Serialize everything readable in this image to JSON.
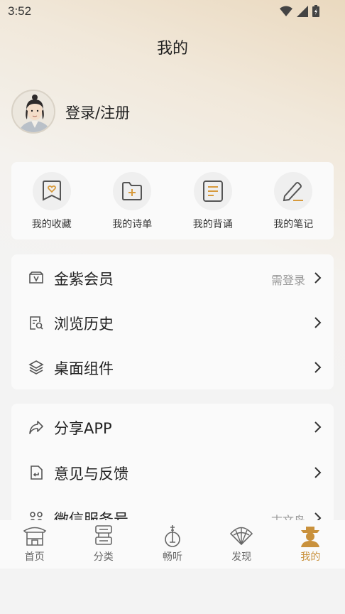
{
  "status": {
    "time": "3:52"
  },
  "header": {
    "title": "我的"
  },
  "profile": {
    "login_label": "登录/注册"
  },
  "shortcuts": [
    {
      "label": "我的收藏",
      "icon": "bookmark-heart-icon"
    },
    {
      "label": "我的诗单",
      "icon": "folder-plus-icon"
    },
    {
      "label": "我的背诵",
      "icon": "document-lines-icon"
    },
    {
      "label": "我的笔记",
      "icon": "pencil-icon"
    }
  ],
  "menu1": [
    {
      "label": "金紫会员",
      "hint": "需登录",
      "icon": "vip-ticket-icon"
    },
    {
      "label": "浏览历史",
      "hint": "",
      "icon": "history-search-icon"
    },
    {
      "label": "桌面组件",
      "hint": "",
      "icon": "layers-icon"
    }
  ],
  "menu2": [
    {
      "label": "分享APP",
      "hint": "",
      "icon": "share-icon"
    },
    {
      "label": "意见与反馈",
      "hint": "",
      "icon": "feedback-icon"
    },
    {
      "label": "微信服务号",
      "hint": "古文岛",
      "icon": "wechat-grid-icon"
    }
  ],
  "tabbar": [
    {
      "label": "首页",
      "icon": "home-pavilion-icon",
      "active": false
    },
    {
      "label": "分类",
      "icon": "scroll-icon",
      "active": false
    },
    {
      "label": "畅听",
      "icon": "pipa-icon",
      "active": false
    },
    {
      "label": "发现",
      "icon": "fan-icon",
      "active": false
    },
    {
      "label": "我的",
      "icon": "scholar-avatar-icon",
      "active": true
    }
  ],
  "colors": {
    "accent": "#c9913c",
    "card": "#fafafa",
    "icon": "#555555"
  }
}
